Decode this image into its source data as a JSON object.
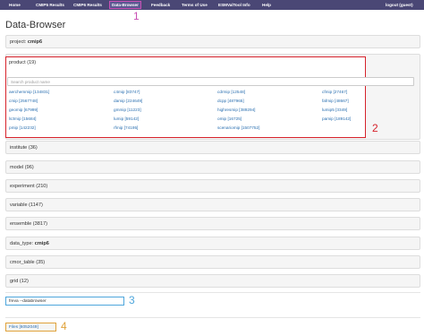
{
  "nav": {
    "items": [
      "Home",
      "CMIP5 Results",
      "CMIP6 Results",
      "Data-Browser",
      "Feedback",
      "Terms of Use",
      "ESMValTool Info",
      "Help"
    ],
    "logout": "logout (guest)"
  },
  "page_title": "Data-Browser",
  "markers": [
    "1",
    "2",
    "3",
    "4"
  ],
  "project": {
    "label": "project:",
    "value": "cmip6"
  },
  "product": {
    "label": "product (19)",
    "search_placeholder": "Search product name",
    "items": [
      "aerchemmip [134831]",
      "c4mip [83747]",
      "cdrmip [12548]",
      "cfmip [27467]",
      "cmip [2567748]",
      "damip [224649]",
      "dcpp [487965]",
      "fafmip [48667]",
      "geomip [67999]",
      "gmmip [11223]",
      "highresmip [389294]",
      "lumip5 [3349]",
      "ls3mip [15684]",
      "lumip [59142]",
      "omip [16725]",
      "pamip [189142]",
      "pmip [142232]",
      "rfmip [74195]",
      "scenariomip [1507752]"
    ]
  },
  "facets": [
    "institute (36)",
    "model (96)",
    "experiment (210)",
    "variable (1147)",
    "ensemble (3817)",
    "cmor_table (35)",
    "grid (12)"
  ],
  "data_type": {
    "label": "data_type:",
    "value": "cmip6"
  },
  "terminal": "freva --databrowser",
  "files": "Files [6052049]",
  "colors": {
    "navbar": "#4a4775",
    "marker_1": "#c84fb4",
    "marker_2": "#d6222b",
    "marker_3": "#4ea6dc",
    "marker_4": "#e0a23a"
  }
}
